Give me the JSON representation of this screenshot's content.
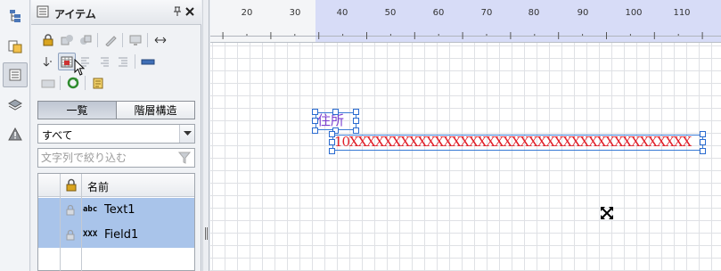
{
  "panel": {
    "title": "アイテム",
    "pin_icon": "pin-icon",
    "close_icon": "close-icon"
  },
  "tabs": [
    {
      "label": "一覧",
      "selected": true
    },
    {
      "label": "階層構造",
      "selected": false
    }
  ],
  "filter": {
    "value": "すべて"
  },
  "search": {
    "placeholder": "文字列で絞り込む"
  },
  "list": {
    "columns": [
      "",
      "",
      "名前"
    ],
    "rows": [
      {
        "type": "abc",
        "name": "Text1",
        "selected": true
      },
      {
        "type": "XXX",
        "name": "Field1",
        "selected": true
      }
    ]
  },
  "ruler": {
    "labels": [
      "20",
      "30",
      "40",
      "50",
      "60",
      "70",
      "80",
      "90",
      "100",
      "110"
    ]
  },
  "canvas": {
    "label_text": "住所",
    "field_text": "10XXXXXXXXXXXXXXXXXXXXXXXXXXXXXXXXXXXXXXXX"
  },
  "colors": {
    "accent_selection": "#a9c4ea",
    "label_color": "#7b3fd0",
    "field_color": "#e0202a",
    "handle_border": "#2a6bd0"
  }
}
